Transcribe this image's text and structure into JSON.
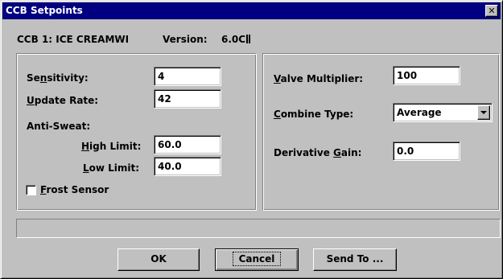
{
  "window": {
    "title": "CCB Setpoints",
    "close_glyph": "✕"
  },
  "header": {
    "unit_label": "CCB 1: ICE CREAMWI",
    "version_label": "Version:",
    "version_value": "6.0C"
  },
  "left_group": {
    "sensitivity": {
      "label_pre": "Se",
      "label_accel": "n",
      "label_post": "sitivity:",
      "value": "4"
    },
    "update_rate": {
      "label_accel": "U",
      "label_post": "pdate Rate:",
      "value": "42"
    },
    "anti_sweat_label": "Anti-Sweat:",
    "high_limit": {
      "label_accel": "H",
      "label_post": "igh Limit:",
      "value": "60.0"
    },
    "low_limit": {
      "label_accel": "L",
      "label_post": "ow Limit:",
      "value": "40.0"
    },
    "frost_sensor": {
      "label_accel": "F",
      "label_post": "rost Sensor",
      "checked": false
    }
  },
  "right_group": {
    "valve_multiplier": {
      "label_accel": "V",
      "label_post": "alve Multiplier:",
      "value": "100"
    },
    "combine_type": {
      "label_accel": "C",
      "label_post": "ombine Type:",
      "value": "Average"
    },
    "derivative_gain": {
      "label_pre": "Derivative ",
      "label_accel": "G",
      "label_post": "ain:",
      "value": "0.0"
    }
  },
  "status_text": "",
  "buttons": {
    "ok": "OK",
    "cancel": "Cancel",
    "send_to": "Send To ..."
  },
  "icons": {
    "close": "close-icon",
    "dropdown": "chevron-down-icon"
  }
}
